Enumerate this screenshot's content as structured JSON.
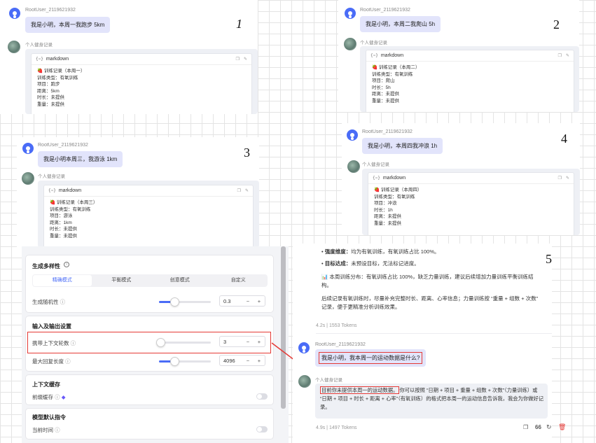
{
  "panel1": {
    "user": "RootUser_2119621932",
    "message": "我是小明，本周一我跑步 5km",
    "assistant_label": "个人健身记录",
    "code_lang": "markdown",
    "lines": [
      "🍓 训练记录（本周一）",
      "训练类型：有氧训练",
      "项目：跑步",
      "距离：5km",
      "时长：未提供",
      "重量：未提供"
    ],
    "num": "1"
  },
  "panel2": {
    "user": "RootUser_2119621932",
    "message": "我是小明，本周二我爬山 5h",
    "assistant_label": "个人健身记录",
    "code_lang": "markdown",
    "lines": [
      "🍓 训练记录（本周二）",
      "训练类型：有氧训练",
      "项目：爬山",
      "时长：5h",
      "距离：未提供",
      "重量：未提供"
    ],
    "num": "2"
  },
  "panel3": {
    "user": "RootUser_2119621932",
    "message": "我是小明本周三，我游泳 1km",
    "assistant_label": "个人健身记录",
    "code_lang": "markdown",
    "lines": [
      "🍓 训练记录（本周三）",
      "训练类型：有氧训练",
      "项目：游泳",
      "距离：1km",
      "时长：未提供",
      "重量：未提供"
    ],
    "num": "3"
  },
  "panel4": {
    "user": "RootUser_2119621932",
    "message": "我是小明，本周四我冲浪 1h",
    "assistant_label": "个人健身记录",
    "code_lang": "markdown",
    "lines": [
      "🍓 训练记录（本周四）",
      "训练类型：有氧训练",
      "项目：冲浪",
      "时长：1h",
      "距离：未提供",
      "重量：未提供"
    ],
    "num": "4"
  },
  "settings": {
    "diversity": {
      "title": "生成多样性",
      "tabs": [
        "精确模式",
        "平衡模式",
        "创意模式",
        "自定义"
      ],
      "active_tab": 0,
      "random_label": "生成随机性",
      "random_value": "0.3",
      "random_fraction": 0.3
    },
    "io": {
      "title": "输入及输出设置",
      "context_label": "携带上下文轮数",
      "context_value": "3",
      "context_fraction": 0.03,
      "maxlen_label": "最大回复长度",
      "maxlen_value": "4096",
      "maxlen_fraction": 0.3
    },
    "cache": {
      "title": "上下文缓存",
      "prefix_label": "前缀缓存"
    },
    "default": {
      "title": "模型默认指令",
      "time_label": "当前时间"
    }
  },
  "chat5": {
    "num": "5",
    "bullet1_b": "强度维度：",
    "bullet1": "均为有氧训练，有氧训练占比 100%。",
    "bullet2_b": "目标达成：",
    "bullet2": "未预设目标，无法标记进度。",
    "analysis": "📊 本周训练分布：有氧训练占比 100%，缺乏力量训练，建议后续增加力量训练平衡训练结构。",
    "tip": "后续记录有氧训练时，尽量补充完整时长、距离、心率信息；力量训练按 “重量 + 组数 + 次数” 记录，便于更精准分析训练效果。",
    "meta1": "4.2s | 1553 Tokens",
    "user": "RootUser_2119621932",
    "question": "我是小明，我本周一的运动数据是什么?",
    "assistant_label": "个人健身记录",
    "answer_hl": "目前你未提供本周一的运动数据。",
    "answer": "你可以按照 “日期 + 项目 + 重量 + 组数 + 次数”（力量训练）或 “日期 + 项目 + 时长 + 距离 + 心率”（有氧训练）的格式把本周一的运动信息告诉我，我会为你做好记录。",
    "meta2": "4.9s | 1497 Tokens",
    "actions": [
      "复制",
      "引用",
      "重新生成",
      "删除"
    ]
  },
  "colors": {
    "accent": "#4a6cf7",
    "highlight": "#e53935",
    "bubble": "#e2e4fb"
  }
}
